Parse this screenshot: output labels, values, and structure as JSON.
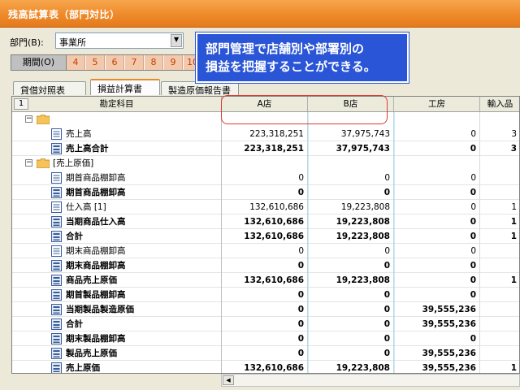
{
  "window": {
    "title": "残高試算表（部門対比）"
  },
  "dept": {
    "label": "部門(B):",
    "value": "事業所"
  },
  "period": {
    "label": "期間(O)",
    "months": [
      "4",
      "5",
      "6",
      "7",
      "8",
      "9",
      "10"
    ]
  },
  "tabs": [
    {
      "label": "貸借対照表",
      "active": false
    },
    {
      "label": "損益計算書",
      "active": true
    },
    {
      "label": "製造原価報告書",
      "active": false
    }
  ],
  "grid": {
    "header": {
      "num": "1",
      "account": "勘定科目",
      "columns": [
        "A店",
        "B店",
        "工房",
        "輸入品"
      ]
    },
    "rows": [
      {
        "label": "[売上高]",
        "kind": "section",
        "selected": true,
        "vals": [
          "",
          "",
          "",
          ""
        ]
      },
      {
        "label": "売上高",
        "kind": "item",
        "bold": false,
        "vals": [
          "223,318,251",
          "37,975,743",
          "0",
          "3"
        ]
      },
      {
        "label": "売上高合計",
        "kind": "total",
        "bold": true,
        "vals": [
          "223,318,251",
          "37,975,743",
          "0",
          "3"
        ]
      },
      {
        "label": "[売上原価]",
        "kind": "section",
        "selected": false,
        "vals": [
          "",
          "",
          "",
          ""
        ]
      },
      {
        "label": "期首商品棚卸高",
        "kind": "item",
        "bold": false,
        "vals": [
          "0",
          "0",
          "0",
          ""
        ]
      },
      {
        "label": "期首商品棚卸高",
        "kind": "total",
        "bold": true,
        "vals": [
          "0",
          "0",
          "0",
          ""
        ]
      },
      {
        "label": "仕入高 [1]",
        "kind": "item",
        "bold": false,
        "vals": [
          "132,610,686",
          "19,223,808",
          "0",
          "1"
        ]
      },
      {
        "label": "当期商品仕入高",
        "kind": "total",
        "bold": true,
        "vals": [
          "132,610,686",
          "19,223,808",
          "0",
          "1"
        ]
      },
      {
        "label": "合計",
        "kind": "total",
        "bold": true,
        "vals": [
          "132,610,686",
          "19,223,808",
          "0",
          "1"
        ]
      },
      {
        "label": "期末商品棚卸高",
        "kind": "item",
        "bold": false,
        "vals": [
          "0",
          "0",
          "0",
          ""
        ]
      },
      {
        "label": "期末商品棚卸高",
        "kind": "total",
        "bold": true,
        "vals": [
          "0",
          "0",
          "0",
          ""
        ]
      },
      {
        "label": "商品売上原価",
        "kind": "total",
        "bold": true,
        "vals": [
          "132,610,686",
          "19,223,808",
          "0",
          "1"
        ]
      },
      {
        "label": "期首製品棚卸高",
        "kind": "total",
        "bold": true,
        "vals": [
          "0",
          "0",
          "0",
          ""
        ]
      },
      {
        "label": "当期製品製造原価",
        "kind": "total",
        "bold": true,
        "vals": [
          "0",
          "0",
          "39,555,236",
          ""
        ]
      },
      {
        "label": "合計",
        "kind": "total",
        "bold": true,
        "vals": [
          "0",
          "0",
          "39,555,236",
          ""
        ]
      },
      {
        "label": "期末製品棚卸高",
        "kind": "total",
        "bold": true,
        "vals": [
          "0",
          "0",
          "0",
          ""
        ]
      },
      {
        "label": "製品売上原価",
        "kind": "total",
        "bold": true,
        "vals": [
          "0",
          "0",
          "39,555,236",
          ""
        ]
      },
      {
        "label": "売上原価",
        "kind": "total",
        "bold": true,
        "vals": [
          "132,610,686",
          "19,223,808",
          "39,555,236",
          "1"
        ]
      }
    ]
  },
  "callout": {
    "line1": "部門管理で店舗別や部署別の",
    "line2": "損益を把握することができる。"
  },
  "colors": {
    "title_bar": "#ee8a2a",
    "callout": "#2a55d6",
    "highlight": "#e0392e",
    "month": "#f3c9ad"
  }
}
